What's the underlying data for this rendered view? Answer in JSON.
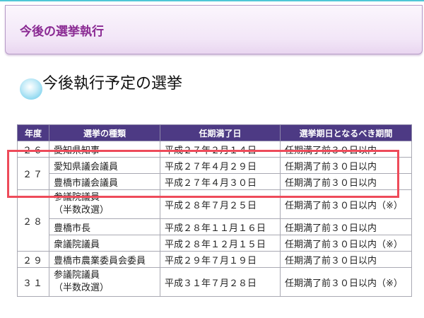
{
  "page": {
    "header_title": "今後の選挙執行",
    "section_title": "今後執行予定の選挙"
  },
  "table": {
    "headers": [
      "年度",
      "選挙の種類",
      "任期満了日",
      "選挙期日となるべき期間"
    ],
    "groups": [
      {
        "year": "２６",
        "rows": [
          {
            "type": [
              "愛知県知事"
            ],
            "expiry": "平成２７年２月１４日",
            "period": "任期満了前３０日以内"
          }
        ]
      },
      {
        "year": "２７",
        "rows": [
          {
            "type": [
              "愛知県議会議員"
            ],
            "expiry": "平成２７年４月２９日",
            "period": "任期満了前３０日以内"
          },
          {
            "type": [
              "豊橋市議会議員"
            ],
            "expiry": "平成２７年４月３０日",
            "period": "任期満了前３０日以内"
          }
        ]
      },
      {
        "year": "２８",
        "rows": [
          {
            "type": [
              "参議院議員",
              "（半数改選）"
            ],
            "expiry": "平成２８年７月２５日",
            "period": "任期満了前３０日以内（※）"
          },
          {
            "type": [
              "豊橋市長"
            ],
            "expiry": "平成２８年１１月１６日",
            "period": "任期満了前３０日以内"
          },
          {
            "type": [
              "衆議院議員"
            ],
            "expiry": "平成２８年１２月１５日",
            "period": "任期満了前３０日以内（※）"
          }
        ]
      },
      {
        "year": "２９",
        "rows": [
          {
            "type": [
              "豊橋市農業委員会委員"
            ],
            "expiry": "平成２９年７月１９日",
            "period": "任期満了前３０日以内"
          }
        ]
      },
      {
        "year": "３１",
        "rows": [
          {
            "type": [
              "参議院議員",
              "（半数改選）"
            ],
            "expiry": "平成３１年７月２８日",
            "period": "任期満了前３０日以内（※）"
          }
        ]
      }
    ]
  },
  "colors": {
    "header_title": "#8a2a93",
    "table_header_bg": "#4d3a84",
    "highlight_border": "#ee4b5a",
    "icon_blue": "#7fd3ee"
  },
  "icons": {
    "section_bullet": "blue-dot-icon"
  }
}
